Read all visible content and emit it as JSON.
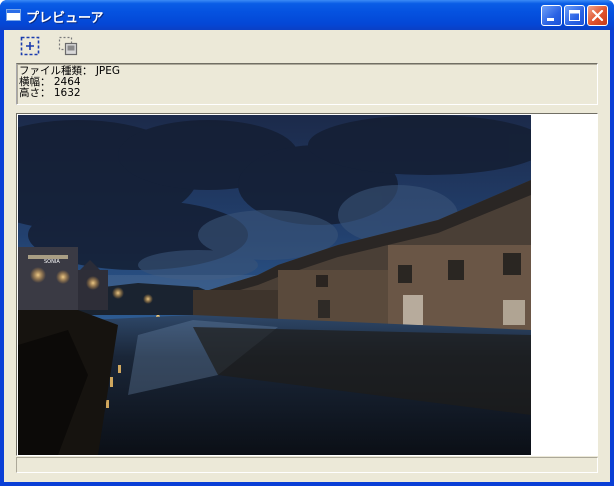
{
  "window": {
    "title": "プレビューア"
  },
  "toolbar": {
    "select_tool": "select-rectangle-icon",
    "copy_tool": "copy-icon"
  },
  "info": {
    "file_type": "ファイル種類： JPEG",
    "width": "横幅： 2464",
    "height": "高さ： 1632"
  },
  "preview": {
    "image": "photo of a canal at dusk with brick warehouses, street lamps and a cloudy blue sky",
    "sign_text": "SONIA"
  },
  "colors": {
    "title_bar": "#0552e0",
    "client_bg": "#ece9d8",
    "close_button": "#e0522c"
  }
}
